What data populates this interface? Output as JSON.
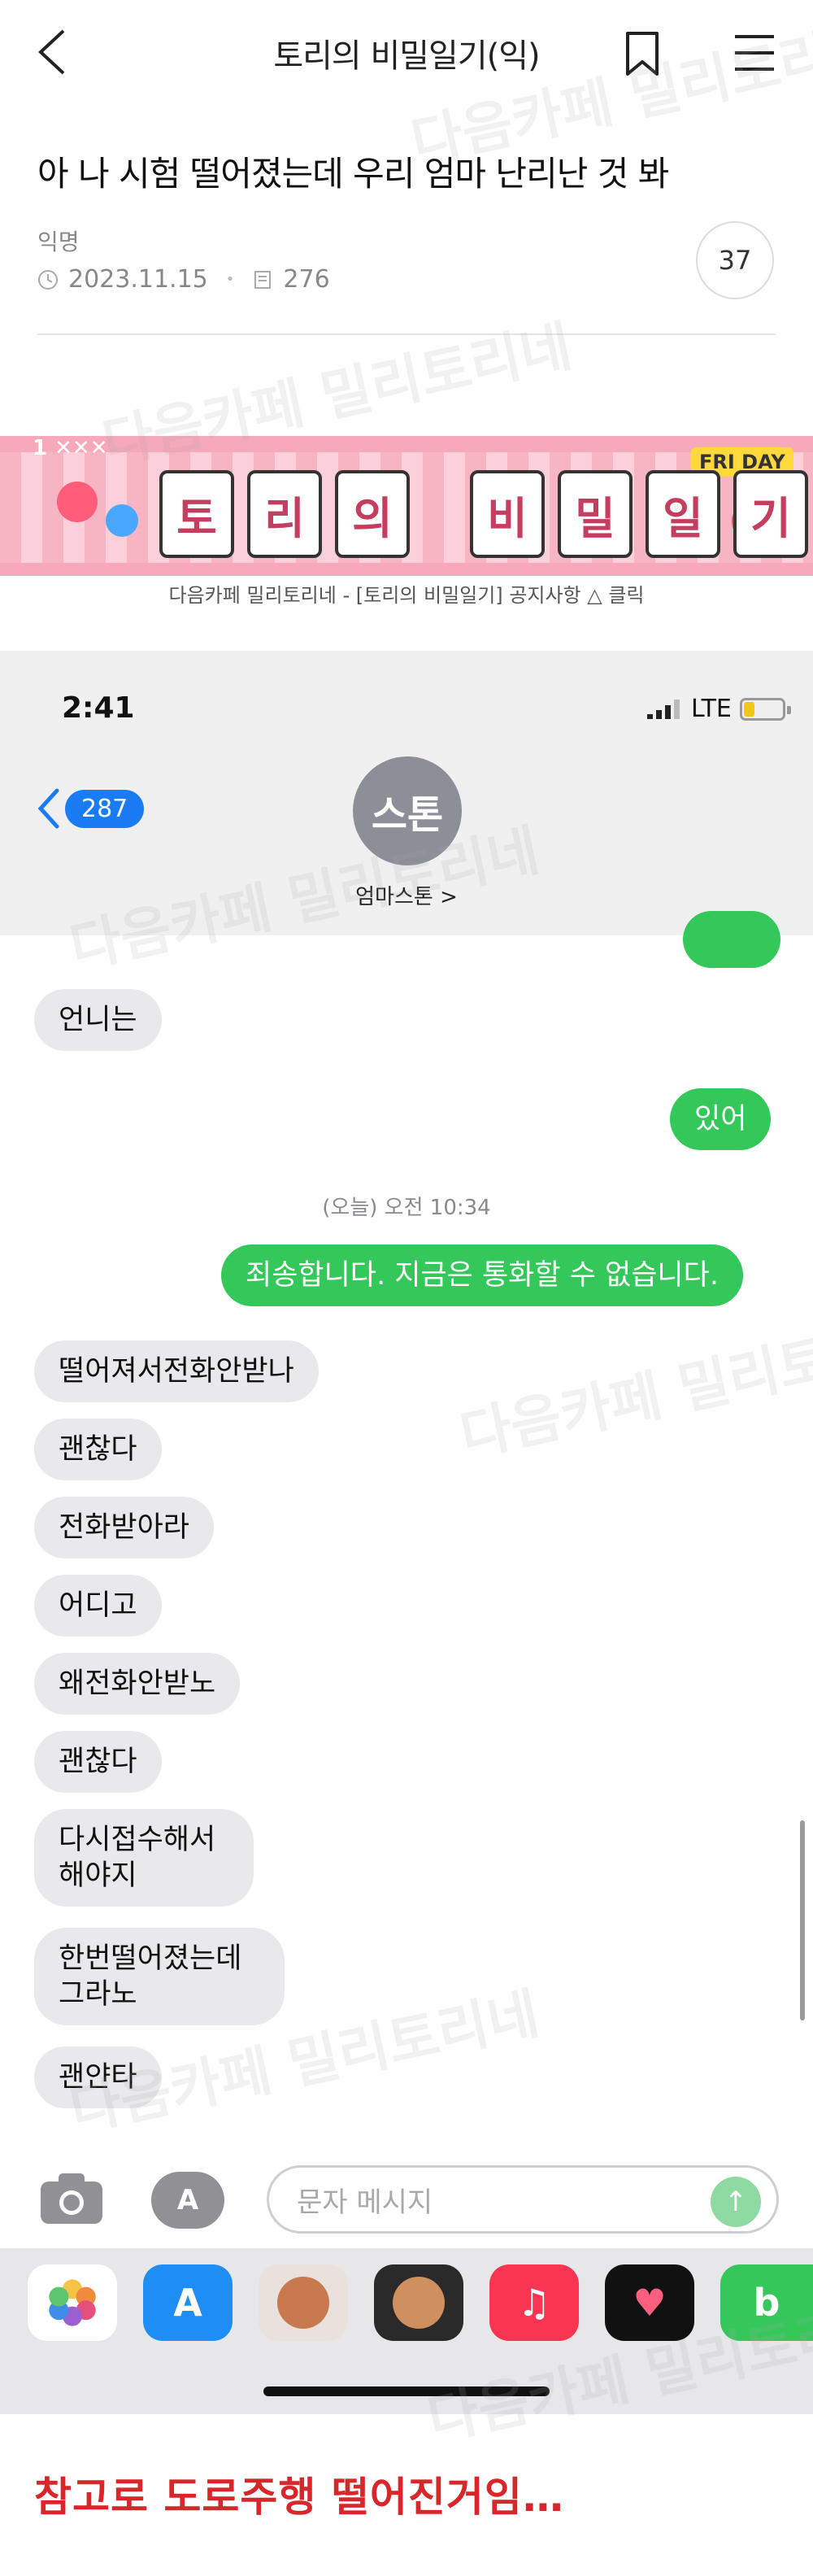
{
  "header": {
    "title": "토리의 비밀일기(익)",
    "back_icon": "chevron-left-icon",
    "bookmark_icon": "bookmark-icon",
    "menu_icon": "hamburger-menu-icon"
  },
  "post": {
    "title": "아 나 시험 떨어졌는데 우리 엄마 난리난 것 봐",
    "author": "익명",
    "date": "2023.11.15",
    "views": "276",
    "comment_count": "37"
  },
  "banner": {
    "tiles": [
      "토",
      "리",
      "의",
      "비",
      "밀",
      "일",
      "기"
    ],
    "date_label": "1 ✕✕✕",
    "day_label": "FRI DAY",
    "caption": "다음카페 밀리토리네 - [토리의 비밀일기] 공지사항 △ 클릭"
  },
  "phone": {
    "status_time": "2:41",
    "network": "LTE",
    "battery_level": 0.25,
    "back_count": "287",
    "avatar_text": "스톤",
    "contact_name": "엄마스톤 >",
    "timestamp": "(오늘) 오전 10:34",
    "messages_before": [
      {
        "type": "in",
        "text": "언니는"
      },
      {
        "type": "out",
        "text": "있어"
      }
    ],
    "auto_reply": "죄송합니다. 지금은 통화할 수 없습니다.",
    "incoming": [
      "떨어져서전화안받나",
      "괜찮다",
      "전화받아라",
      "어디고",
      "왜전화안받노",
      "괜찮다",
      "다시접수해서 해야지",
      "한번떨어졌는데 그라노",
      "괜얀타"
    ],
    "input_placeholder": "문자 메시지",
    "dock_apps": [
      "photos-icon",
      "app-store-icon",
      "memoji-icon",
      "memoji-2-icon",
      "music-icon",
      "heart-sticker-icon",
      "beeper-icon"
    ],
    "colors": {
      "imessage_blue": "#1a7cf5",
      "sms_green": "#34c759",
      "incoming_gray": "#e9e9eb"
    }
  },
  "footer": {
    "note": "참고로 도로주행 떨어진거임…"
  },
  "watermark": "다음카페 밀리토리네"
}
